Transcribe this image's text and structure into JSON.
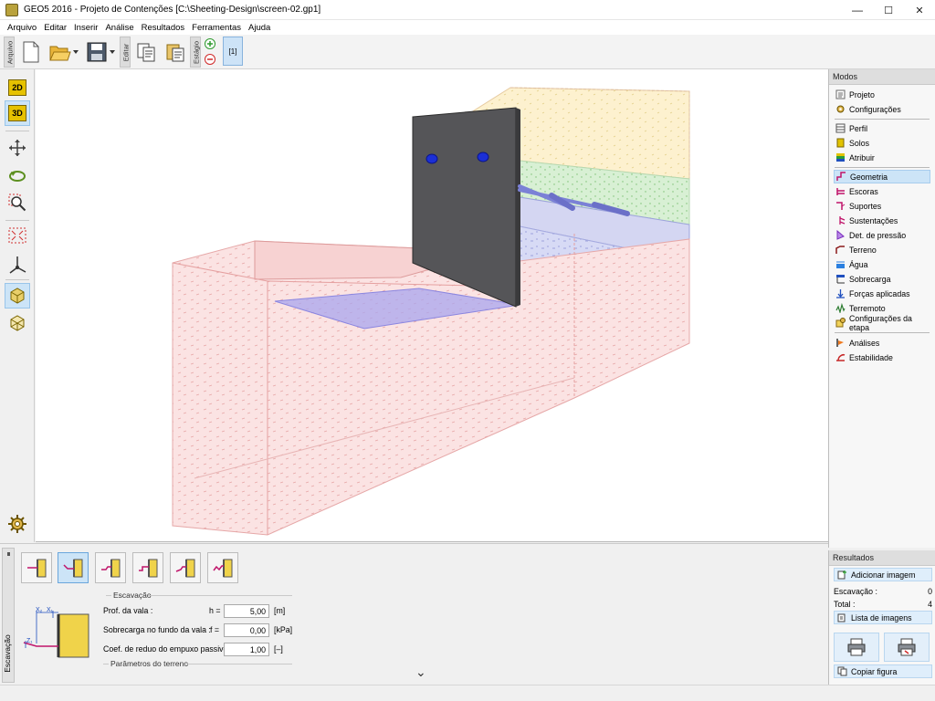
{
  "window": {
    "title": "GEO5 2016 - Projeto de Contenções [C:\\Sheeting-Design\\screen-02.gp1]",
    "controls": {
      "minimize": "—",
      "maximize": "☐",
      "close": "✕"
    }
  },
  "menu": [
    "Arquivo",
    "Editar",
    "Inserir",
    "Análise",
    "Resultados",
    "Ferramentas",
    "Ajuda"
  ],
  "toolbar": {
    "groups": {
      "file": "Arquivo",
      "edit": "Editar",
      "stage": "Estágio"
    },
    "stage_tab": "[1]"
  },
  "left_tools": {
    "view2d": "2D",
    "view3d": "3D"
  },
  "modes": {
    "header": "Modos",
    "items": [
      {
        "label": "Projeto",
        "icon": "project-icon",
        "color": "#6a6a6a"
      },
      {
        "label": "Configurações",
        "icon": "settings-icon",
        "color": "#8a6d00"
      },
      {
        "label": "Perfil",
        "icon": "profile-icon",
        "color": "#555555"
      },
      {
        "label": "Solos",
        "icon": "soils-icon",
        "color": "#e2c300"
      },
      {
        "label": "Atribuir",
        "icon": "assign-icon",
        "color": "#1f4fbf"
      },
      {
        "label": "Geometria",
        "icon": "geometry-icon",
        "color": "#c0146a"
      },
      {
        "label": "Escoras",
        "icon": "struts-icon",
        "color": "#c0146a"
      },
      {
        "label": "Suportes",
        "icon": "supports-icon",
        "color": "#c0146a"
      },
      {
        "label": "Sustentações",
        "icon": "props-icon",
        "color": "#c0146a"
      },
      {
        "label": "Det. de pressão",
        "icon": "pressure-icon",
        "color": "#7a2dbd"
      },
      {
        "label": "Terreno",
        "icon": "terrain-icon",
        "color": "#8b1a1a"
      },
      {
        "label": "Água",
        "icon": "water-icon",
        "color": "#2a7fe0"
      },
      {
        "label": "Sobrecarga",
        "icon": "surcharge-icon",
        "color": "#1f4fbf"
      },
      {
        "label": "Forças aplicadas",
        "icon": "forces-icon",
        "color": "#1f4fbf"
      },
      {
        "label": "Terremoto",
        "icon": "earthquake-icon",
        "color": "#2e7d32"
      },
      {
        "label": "Configurações da etapa",
        "icon": "stage-settings-icon",
        "color": "#c9a000"
      },
      {
        "label": "Análises",
        "icon": "analysis-icon",
        "color": "#d45a00"
      },
      {
        "label": "Estabilidade",
        "icon": "stability-icon",
        "color": "#c62828"
      }
    ],
    "selected": "Geometria"
  },
  "bottom_panel": {
    "tab_label": "Escavação",
    "excavation_title": "Escavação",
    "fields": [
      {
        "label": "Prof. da vala :",
        "symbol": "h =",
        "value": "5,00",
        "unit": "[m]"
      },
      {
        "label": "Sobrecarga no fundo da vala :",
        "symbol": "f =",
        "value": "0,00",
        "unit": "[kPa]"
      },
      {
        "label": "Coef. de reduo do empuxo passivo :",
        "symbol": "",
        "value": "1,00",
        "unit": "[–]"
      }
    ],
    "terrain_title": "Parâmetros do terreno",
    "diagram_labels": {
      "x2": "X₂",
      "x1": "X₁",
      "z1": "Z₁"
    },
    "collapse_glyph": "⌄"
  },
  "results": {
    "header": "Resultados",
    "add_image": "Adicionar imagem",
    "rows": [
      {
        "label": "Escavação :",
        "value": "0"
      },
      {
        "label": "Total :",
        "value": "4"
      }
    ],
    "image_list": "Lista de imagens",
    "copy_figure": "Copiar figura"
  }
}
